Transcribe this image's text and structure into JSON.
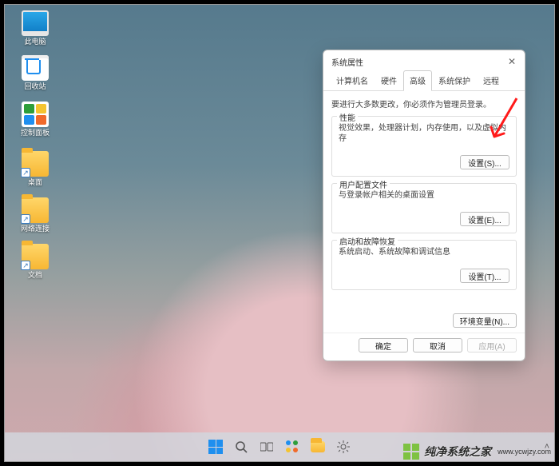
{
  "desktop": {
    "icons": [
      {
        "name": "此电脑",
        "kind": "pc",
        "shortcut": false
      },
      {
        "name": "回收站",
        "kind": "bin",
        "shortcut": false
      },
      {
        "name": "控制面板",
        "kind": "cpl",
        "shortcut": false
      },
      {
        "name": "桌面",
        "kind": "folder",
        "shortcut": true
      },
      {
        "name": "网络连接",
        "kind": "folder",
        "shortcut": true
      },
      {
        "name": "文档",
        "kind": "folder",
        "shortcut": true
      }
    ]
  },
  "dialog": {
    "title": "系统属性",
    "tabs": [
      "计算机名",
      "硬件",
      "高级",
      "系统保护",
      "远程"
    ],
    "active_tab": 2,
    "note": "要进行大多数更改，你必须作为管理员登录。",
    "performance": {
      "title": "性能",
      "desc": "视觉效果，处理器计划，内存使用，以及虚拟内存",
      "button": "设置(S)..."
    },
    "profiles": {
      "title": "用户配置文件",
      "desc": "与登录帐户相关的桌面设置",
      "button": "设置(E)..."
    },
    "startup": {
      "title": "启动和故障恢复",
      "desc": "系统启动、系统故障和调试信息",
      "button": "设置(T)..."
    },
    "env_button": "环境变量(N)...",
    "ok": "确定",
    "cancel": "取消",
    "apply": "应用(A)"
  },
  "watermark": {
    "text": "纯净系统之家",
    "url": "www.ycwjzy.com"
  }
}
